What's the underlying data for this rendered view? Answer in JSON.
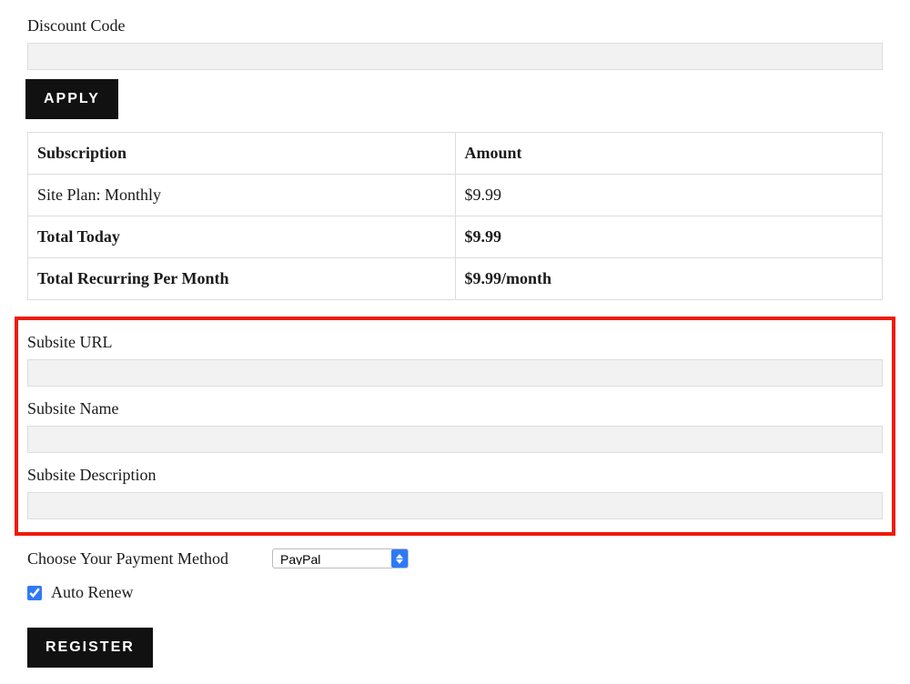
{
  "discount": {
    "label": "Discount Code",
    "value": "",
    "apply_label": "APPLY"
  },
  "table": {
    "col_subscription": "Subscription",
    "col_amount": "Amount",
    "rows": [
      {
        "name": "Site Plan: Monthly",
        "amount": "$9.99",
        "bold": false
      },
      {
        "name": "Total Today",
        "amount": "$9.99",
        "bold": true
      },
      {
        "name": "Total Recurring Per Month",
        "amount": "$9.99/month",
        "bold": true
      }
    ]
  },
  "subsite": {
    "url_label": "Subsite URL",
    "url_value": "",
    "name_label": "Subsite Name",
    "name_value": "",
    "desc_label": "Subsite Description",
    "desc_value": ""
  },
  "payment": {
    "label": "Choose Your Payment Method",
    "selected": "PayPal"
  },
  "auto_renew": {
    "label": "Auto Renew",
    "checked": true
  },
  "register_label": "REGISTER"
}
